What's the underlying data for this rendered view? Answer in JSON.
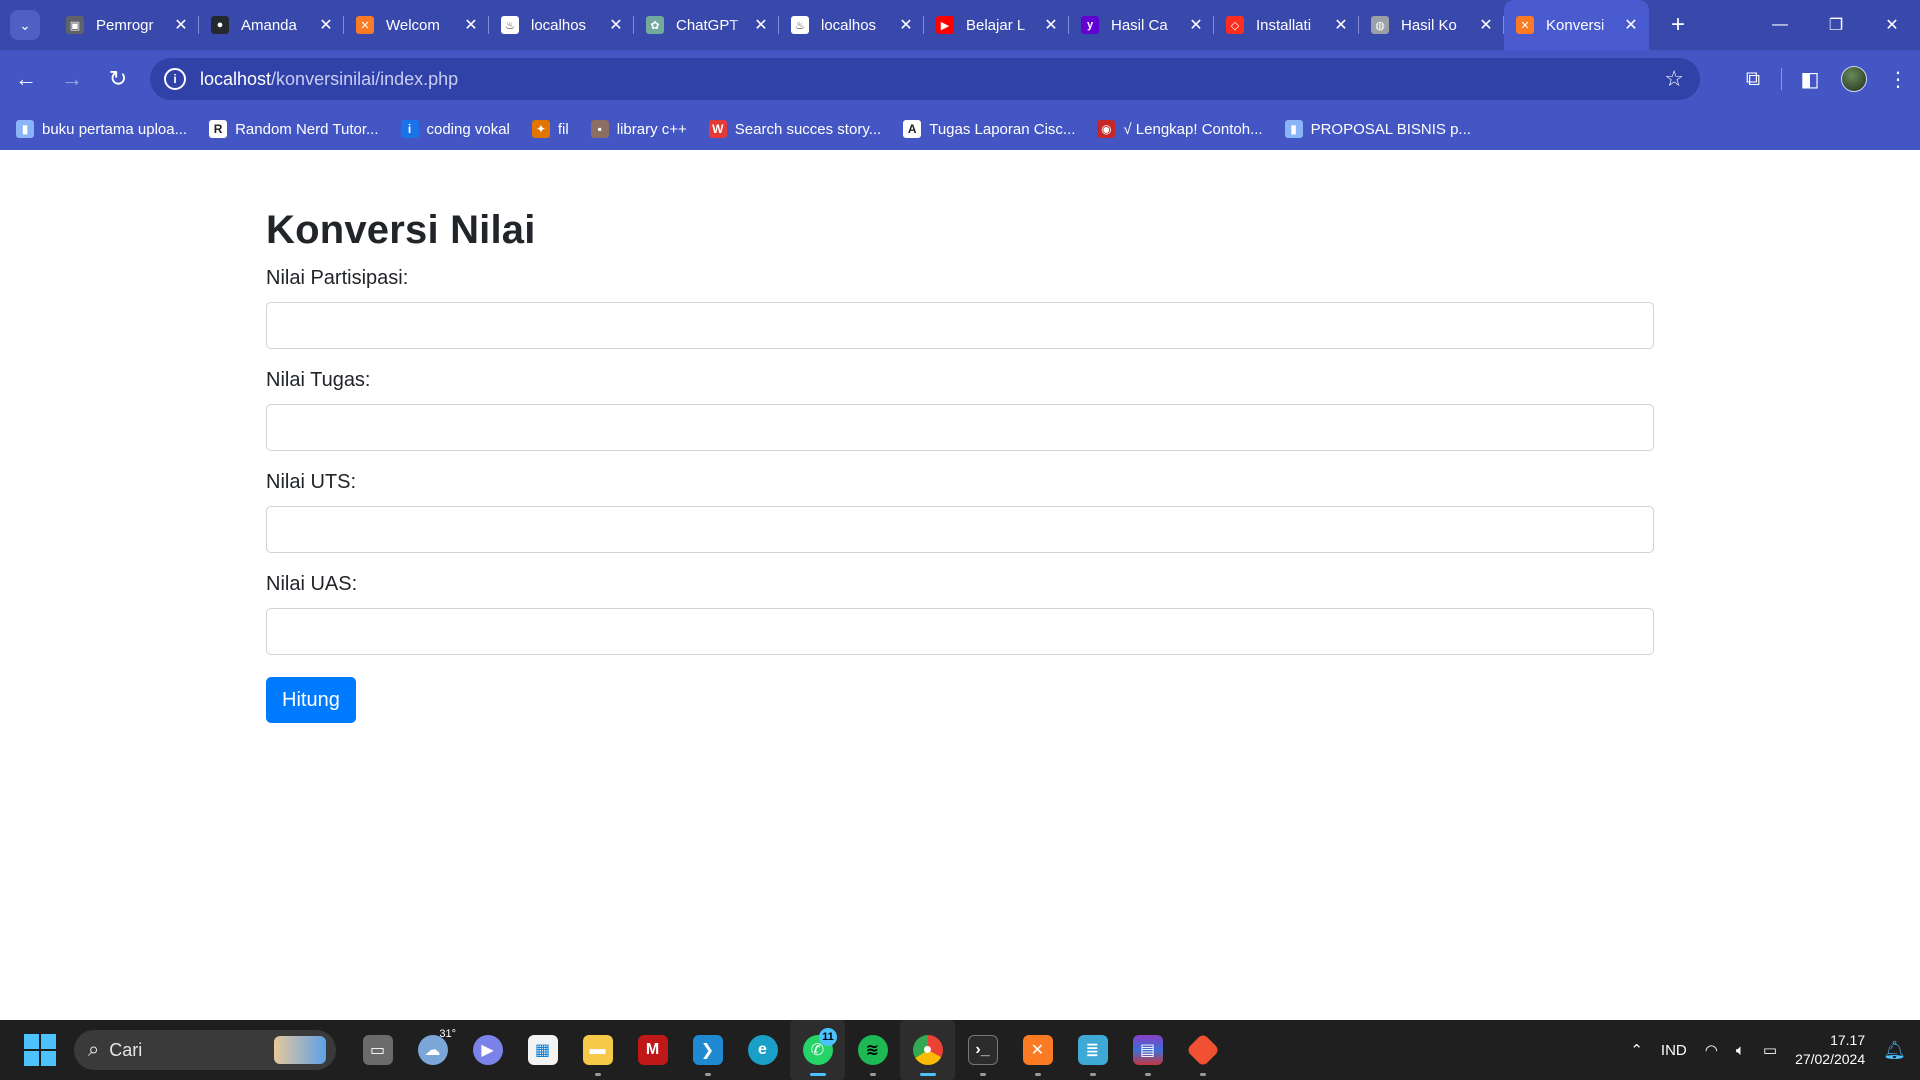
{
  "tabs": [
    {
      "title": "Pemrogr",
      "color": "#5f6368",
      "glyph": "▣"
    },
    {
      "title": "Amanda",
      "color": "#24292e",
      "glyph": "●"
    },
    {
      "title": "Welcom",
      "color": "#fb7a24",
      "glyph": "✕"
    },
    {
      "title": "localhos",
      "color": "#ffffff",
      "glyph": "♨"
    },
    {
      "title": "ChatGPT",
      "color": "#74aa9c",
      "glyph": "✿"
    },
    {
      "title": "localhos",
      "color": "#ffffff",
      "glyph": "♨"
    },
    {
      "title": "Belajar L",
      "color": "#ff0000",
      "glyph": "▶"
    },
    {
      "title": "Hasil Ca",
      "color": "#6001d2",
      "glyph": "y"
    },
    {
      "title": "Installati",
      "color": "#ff2d20",
      "glyph": "◇"
    },
    {
      "title": "Hasil Ko",
      "color": "#9aa0a6",
      "glyph": "◍"
    },
    {
      "title": "Konversi",
      "color": "#fb7a24",
      "glyph": "✕",
      "active": true
    }
  ],
  "address": {
    "host": "localhost",
    "path": "/konversinilai/index.php"
  },
  "bookmarks": [
    {
      "label": "buku pertama uploa...",
      "color": "#8ab4f8",
      "glyph": "▮"
    },
    {
      "label": "Random Nerd Tutor...",
      "color": "#ffffff",
      "glyph": "R"
    },
    {
      "label": "coding vokal",
      "color": "#1a73e8",
      "glyph": "i"
    },
    {
      "label": "fil",
      "color": "#e37400",
      "glyph": "✦"
    },
    {
      "label": "library c++",
      "color": "#8d6e63",
      "glyph": "▪"
    },
    {
      "label": "Search succes story...",
      "color": "#e53935",
      "glyph": "W"
    },
    {
      "label": "Tugas Laporan Cisc...",
      "color": "#ffffff",
      "glyph": "A"
    },
    {
      "label": "√ Lengkap! Contoh...",
      "color": "#c62828",
      "glyph": "◉"
    },
    {
      "label": "PROPOSAL BISNIS p...",
      "color": "#8ab4f8",
      "glyph": "▮"
    }
  ],
  "page": {
    "heading": "Konversi Nilai",
    "fields": [
      {
        "label": "Nilai Partisipasi:",
        "value": ""
      },
      {
        "label": "Nilai Tugas:",
        "value": ""
      },
      {
        "label": "Nilai UTS:",
        "value": ""
      },
      {
        "label": "Nilai UAS:",
        "value": ""
      }
    ],
    "submit_label": "Hitung"
  },
  "taskbar": {
    "search_placeholder": "Cari",
    "weather_temp": "31°",
    "whatsapp_badge": "11",
    "language": "IND",
    "time": "17.17",
    "date": "27/02/2024"
  },
  "colors": {
    "chrome_frame": "#3949ab",
    "toolbar": "#4456c3",
    "primary_button": "#007bff"
  }
}
